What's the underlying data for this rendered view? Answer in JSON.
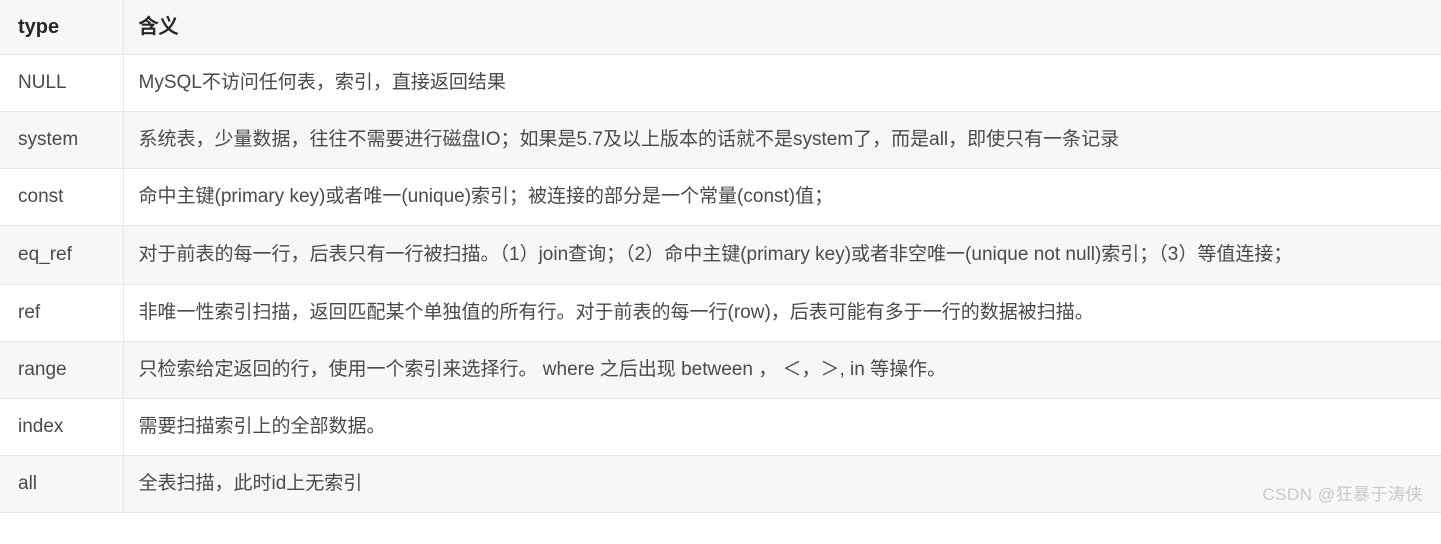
{
  "table": {
    "headers": [
      "type",
      "含义"
    ],
    "rows": [
      {
        "type": "NULL",
        "desc": "MySQL不访问任何表，索引，直接返回结果"
      },
      {
        "type": "system",
        "desc": "系统表，少量数据，往往不需要进行磁盘IO；如果是5.7及以上版本的话就不是system了，而是all，即使只有一条记录"
      },
      {
        "type": "const",
        "desc": "命中主键(primary key)或者唯一(unique)索引；被连接的部分是一个常量(const)值；"
      },
      {
        "type": "eq_ref",
        "desc": "对于前表的每一行，后表只有一行被扫描。（1）join查询；（2）命中主键(primary key)或者非空唯一(unique not null)索引；（3）等值连接；"
      },
      {
        "type": "ref",
        "desc": "非唯一性索引扫描，返回匹配某个单独值的所有行。对于前表的每一行(row)，后表可能有多于一行的数据被扫描。"
      },
      {
        "type": "range",
        "desc": "只检索给定返回的行，使用一个索引来选择行。 where 之后出现 between ， ＜，＞, in 等操作。"
      },
      {
        "type": "index",
        "desc": "需要扫描索引上的全部数据。"
      },
      {
        "type": "all",
        "desc": "全表扫描，此时id上无索引"
      }
    ]
  },
  "watermark": {
    "text": "CSDN @狂暴于涛侠"
  },
  "colors": {
    "header_bg": "#f7f7f7",
    "stripe_bg": "#f7f7f7",
    "row_bg": "#ffffff",
    "border": "#e8e8e8",
    "text": "#4a4a4a",
    "header_text": "#262626",
    "watermark": "#c9c9c9"
  }
}
